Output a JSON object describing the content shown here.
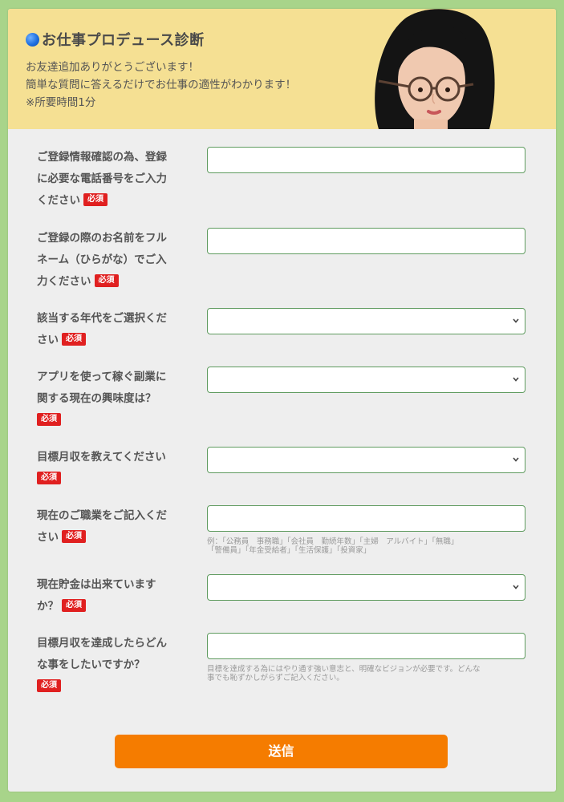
{
  "header": {
    "title": "お仕事プロデュース診断",
    "intro_lines": [
      "お友達追加ありがとうございます！",
      "簡単な質問に答えるだけでお仕事の適性がわかります！",
      "※所要時間1分"
    ]
  },
  "required_badge": "必須",
  "questions": [
    {
      "label_lines": [
        "ご登録情報確認の為、登録",
        "に必要な電話番号をご入力",
        "ください"
      ],
      "type": "text",
      "value": ""
    },
    {
      "label_lines": [
        "ご登録の際のお名前をフル",
        "ネーム（ひらがな）でご入",
        "力ください"
      ],
      "type": "text",
      "value": ""
    },
    {
      "label_lines": [
        "該当する年代をご選択くだ",
        "さい"
      ],
      "type": "select",
      "value": ""
    },
    {
      "label_lines": [
        "アプリを使って稼ぐ副業に",
        "関する現在の興味度は？"
      ],
      "type": "select",
      "value": ""
    },
    {
      "label_lines": [
        "目標月収を教えてください"
      ],
      "type": "select",
      "value": ""
    },
    {
      "label_lines": [
        "現在のご職業をご記入くだ",
        "さい"
      ],
      "type": "text",
      "value": "",
      "hint_lines": [
        "例：「公務員　事務職」「会社員　勤続年数」「主婦　アルバイト」「無職」",
        "「警備員」「年金受給者」「生活保護」「投資家」"
      ]
    },
    {
      "label_lines": [
        "現在貯金は出来ています",
        "か？"
      ],
      "type": "select",
      "value": ""
    },
    {
      "label_lines": [
        "目標月収を達成したらどん",
        "な事をしたいですか？"
      ],
      "type": "text",
      "value": "",
      "hint_lines": [
        "目標を達成する為にはやり通す強い意志と、明確なビジョンが必要です。どんな",
        "事でも恥ずかしがらずご記入ください。"
      ]
    }
  ],
  "submit_label": "送信",
  "colors": {
    "page_bg": "#a8d48a",
    "header_bg": "#f5e093",
    "form_bg": "#eeeeee",
    "field_border": "#5f9b5f",
    "required_badge": "#e02020",
    "submit_button": "#f57c00"
  },
  "icons": {
    "title_bullet": "blue-circle-icon",
    "select_arrow": "chevron-down-icon"
  }
}
